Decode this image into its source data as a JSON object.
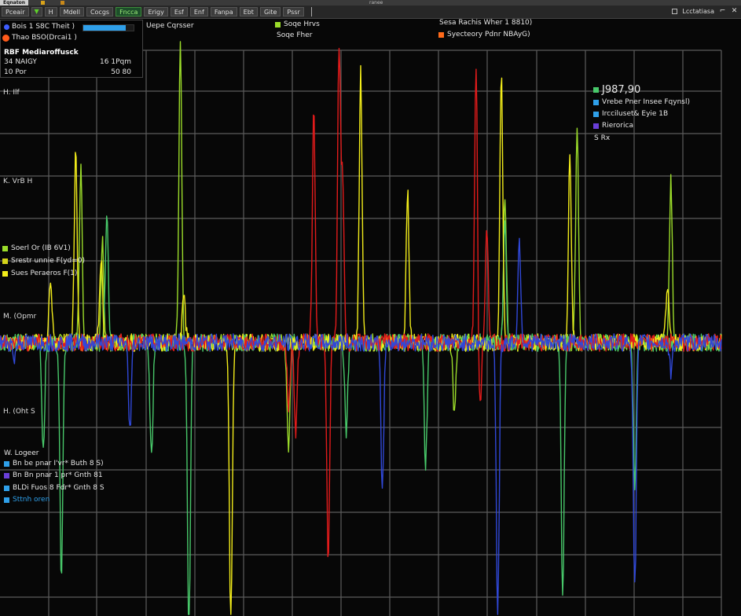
{
  "window": {
    "app_badge": "Eqnaton",
    "title": "ranee"
  },
  "toolbar": {
    "buttons": [
      "Pceair",
      "H",
      "Mdell",
      "Cocgs",
      "Fncca",
      "Erigy",
      "Esf",
      "Enf",
      "Fanpa",
      "Ebt",
      "Gite",
      "Pssr"
    ],
    "active_index": 4,
    "layout_label": "Lcctatiasa"
  },
  "info_panel": {
    "row1_label": "Bois 1 S8C Theit )",
    "progress": 0.85,
    "row2_label": "Thao BSO(Drcai1 )",
    "section_title": "RBF Mediaroffusck",
    "stats": [
      {
        "label": "34 NAIGY",
        "value": "16 1Pqm"
      },
      {
        "label": "10 Por",
        "value": "50 80"
      }
    ]
  },
  "top_labels": {
    "cursor_caption": "Uepe Cqrsser",
    "legend1": "Soqe Hrvs",
    "legend2": "Soqe Fher",
    "readout_title": "Sesa Rachis Wher 1 8810)",
    "readout_sub": "Syecteory Pdnr NBAyG)"
  },
  "right_legend": {
    "value": "J987,90",
    "items": [
      "Vrebe Pner Insee Fqynsl)",
      "Ircciluset& Eyie 1B",
      "Rierorica"
    ],
    "footer": "S Rx"
  },
  "left_legend": {
    "items": [
      "Soerl Or (IB 6V1)",
      "Srestr unnie F(yd=0)",
      "Sues Peraeros F(1)"
    ]
  },
  "bottom_legend": {
    "title": "W. Logeer",
    "items": [
      "Bn be pnar I'vr* Buth 8 S)",
      "Bn Bn pnar 1 pr* Gnth 81",
      "BLDi Fuos 8 Fdr* Gnth 8 S",
      "Sttnh oren"
    ]
  },
  "y_labels": [
    "H.  Ilf",
    "K.  VrB H",
    "M.  (Opmr",
    "H.  (Oht S"
  ],
  "colors": {
    "green": "#48c86a",
    "lime": "#9bdc2a",
    "yellow": "#f2ec1a",
    "red": "#e21b1b",
    "blue": "#3048d8",
    "accent_blue": "#2fa0ea",
    "grid": "#5c5c5c",
    "background": "#070707"
  },
  "chart_data": {
    "type": "line",
    "title": "",
    "xlabel": "",
    "ylabel": "",
    "baseline": 0,
    "ylim": [
      -1,
      1
    ],
    "grid": true,
    "series": [
      {
        "color": "#9bdc2a",
        "peaks": [
          [
            0.112,
            0.6
          ],
          [
            0.142,
            0.35
          ],
          [
            0.25,
            1.05
          ],
          [
            0.4,
            -0.35
          ],
          [
            0.63,
            -0.25
          ],
          [
            0.7,
            0.5
          ],
          [
            0.8,
            0.75
          ],
          [
            0.93,
            0.55
          ]
        ]
      },
      {
        "color": "#48c86a",
        "peaks": [
          [
            0.06,
            -0.38
          ],
          [
            0.085,
            -0.8
          ],
          [
            0.148,
            0.44
          ],
          [
            0.21,
            -0.4
          ],
          [
            0.262,
            -1.05
          ],
          [
            0.48,
            -0.3
          ],
          [
            0.59,
            -0.42
          ],
          [
            0.7,
            0.4
          ],
          [
            0.78,
            -0.88
          ],
          [
            0.88,
            -0.5
          ]
        ]
      },
      {
        "color": "#f2ec1a",
        "peaks": [
          [
            0.07,
            0.22
          ],
          [
            0.105,
            0.68
          ],
          [
            0.14,
            0.3
          ],
          [
            0.255,
            0.18
          ],
          [
            0.32,
            -0.98
          ],
          [
            0.5,
            0.93
          ],
          [
            0.565,
            0.52
          ],
          [
            0.695,
            0.93
          ],
          [
            0.79,
            0.65
          ],
          [
            0.925,
            0.2
          ]
        ]
      },
      {
        "color": "#e21b1b",
        "peaks": [
          [
            0.4,
            -0.22
          ],
          [
            0.41,
            -0.3
          ],
          [
            0.435,
            0.8
          ],
          [
            0.455,
            -0.75
          ],
          [
            0.47,
            1.0
          ],
          [
            0.475,
            0.55
          ],
          [
            0.66,
            0.98
          ],
          [
            0.665,
            -0.25
          ],
          [
            0.675,
            0.4
          ]
        ]
      },
      {
        "color": "#3048d8",
        "peaks": [
          [
            0.02,
            -0.05
          ],
          [
            0.18,
            -0.3
          ],
          [
            0.53,
            -0.5
          ],
          [
            0.69,
            -0.95
          ],
          [
            0.72,
            0.35
          ],
          [
            0.88,
            -0.85
          ],
          [
            0.93,
            -0.1
          ]
        ]
      }
    ]
  }
}
